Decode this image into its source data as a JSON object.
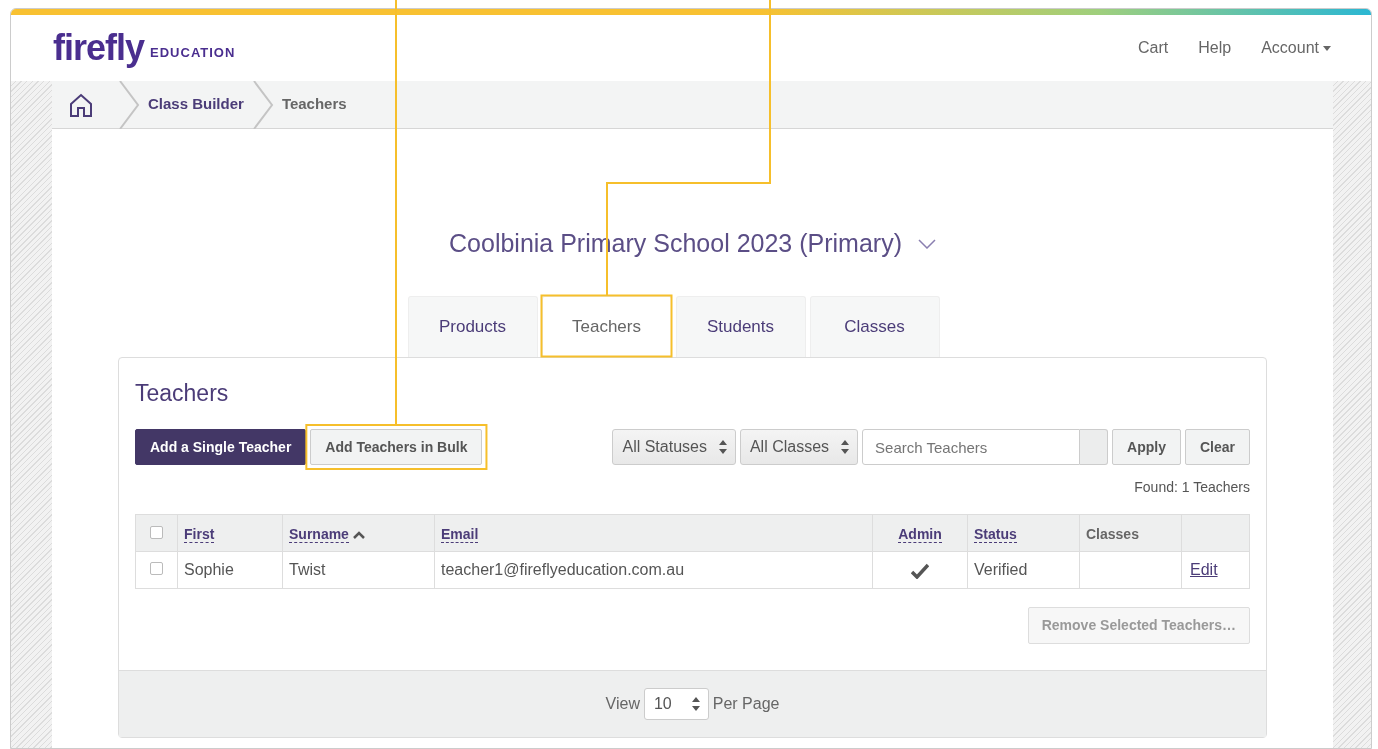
{
  "logo": {
    "name": "firefly",
    "tagline": "EDUCATION"
  },
  "nav": [
    {
      "label": "Cart",
      "kind": "link"
    },
    {
      "label": "Help",
      "kind": "link"
    },
    {
      "label": "Account",
      "kind": "dropdown"
    }
  ],
  "breadcrumb": [
    {
      "label": "Class Builder",
      "current": false
    },
    {
      "label": "Teachers",
      "current": true
    }
  ],
  "school": {
    "title": "Coolbinia Primary School 2023 (Primary)"
  },
  "tabs": [
    {
      "label": "Products",
      "selected": false,
      "highlighted": false
    },
    {
      "label": "Teachers",
      "selected": true,
      "highlighted": true
    },
    {
      "label": "Students",
      "selected": false,
      "highlighted": false
    },
    {
      "label": "Classes",
      "selected": false,
      "highlighted": false
    }
  ],
  "panel": {
    "title": "Teachers",
    "actions": [
      {
        "label": "Add a Single Teacher",
        "kind": "primary",
        "highlighted": false
      },
      {
        "label": "Add Teachers in Bulk",
        "kind": "secondary",
        "highlighted": true
      }
    ],
    "filters": [
      {
        "value": "All Statuses"
      },
      {
        "value": "All Classes"
      }
    ],
    "search": {
      "placeholder": "Search Teachers"
    },
    "filter_buttons": [
      "Apply",
      "Clear"
    ],
    "found": "Found: 1 Teachers",
    "table": {
      "select_all": {
        "checked": false
      },
      "columns": [
        {
          "label": "First",
          "sortable": true
        },
        {
          "label": "Surname",
          "sortable": true,
          "sorted": true
        },
        {
          "label": "Email",
          "sortable": true
        },
        {
          "label": "Admin",
          "sortable": true
        },
        {
          "label": "Status",
          "sortable": true
        },
        {
          "label": "Classes",
          "sortable": false
        }
      ],
      "rows": [
        {
          "selected": false,
          "first": "Sophie",
          "surname": "Twist",
          "email": "teacher1@fireflyeducation.com.au",
          "admin": true,
          "status": "Verified",
          "action": "Edit"
        }
      ]
    },
    "remove_button": {
      "label": "Remove Selected Teachers…",
      "disabled": true
    },
    "pagination": {
      "before": "View",
      "per_page": "10",
      "after": "Per Page"
    }
  }
}
